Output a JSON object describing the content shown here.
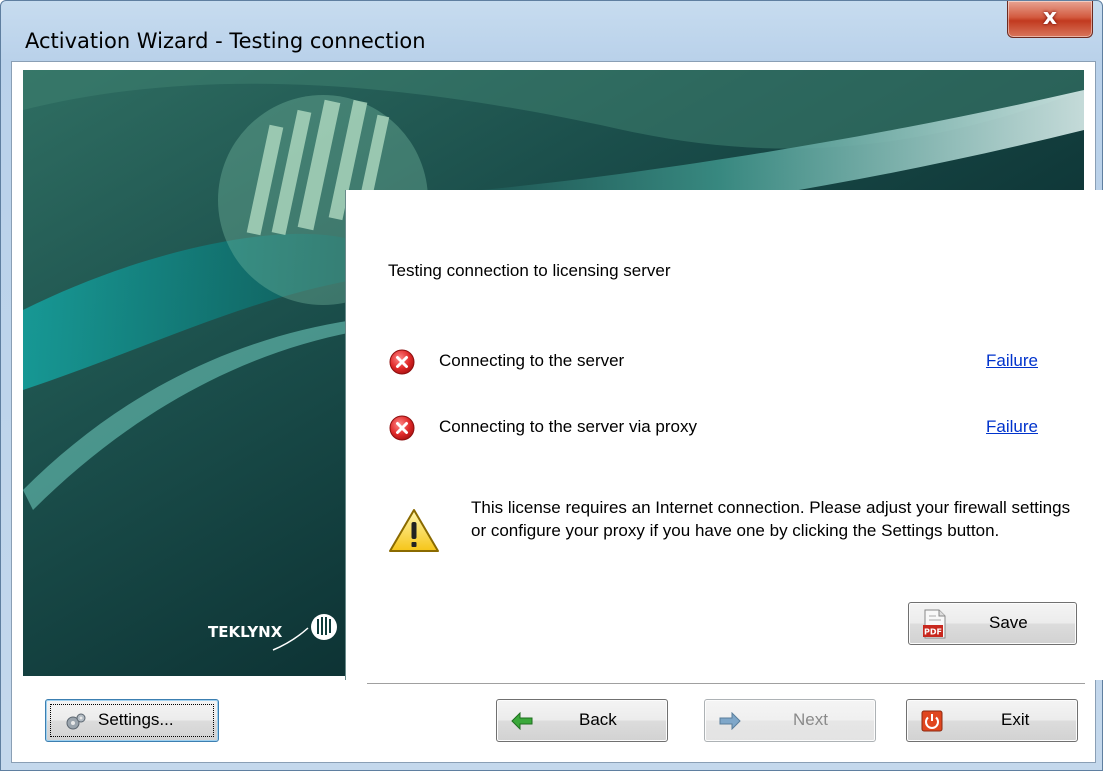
{
  "window": {
    "title": "Activation Wizard - Testing connection",
    "close_label": "x"
  },
  "banner": {
    "logo_text": "TEKLYNX"
  },
  "content": {
    "heading": "Testing connection to licensing server",
    "checks": [
      {
        "label": "Connecting to the server",
        "status": "Failure",
        "icon": "error-icon"
      },
      {
        "label": "Connecting to the server via proxy",
        "status": "Failure",
        "icon": "error-icon"
      }
    ],
    "warning": {
      "icon": "warning-icon",
      "text": "This license requires an Internet connection. Please adjust your firewall settings or configure your proxy if you have one by clicking the Settings button."
    }
  },
  "buttons": {
    "save": "Save",
    "settings": "Settings...",
    "back": "Back",
    "next": "Next",
    "exit": "Exit"
  },
  "colors": {
    "link": "#0033cc",
    "error": "#d8232a",
    "banner": "#0f3c3b"
  }
}
